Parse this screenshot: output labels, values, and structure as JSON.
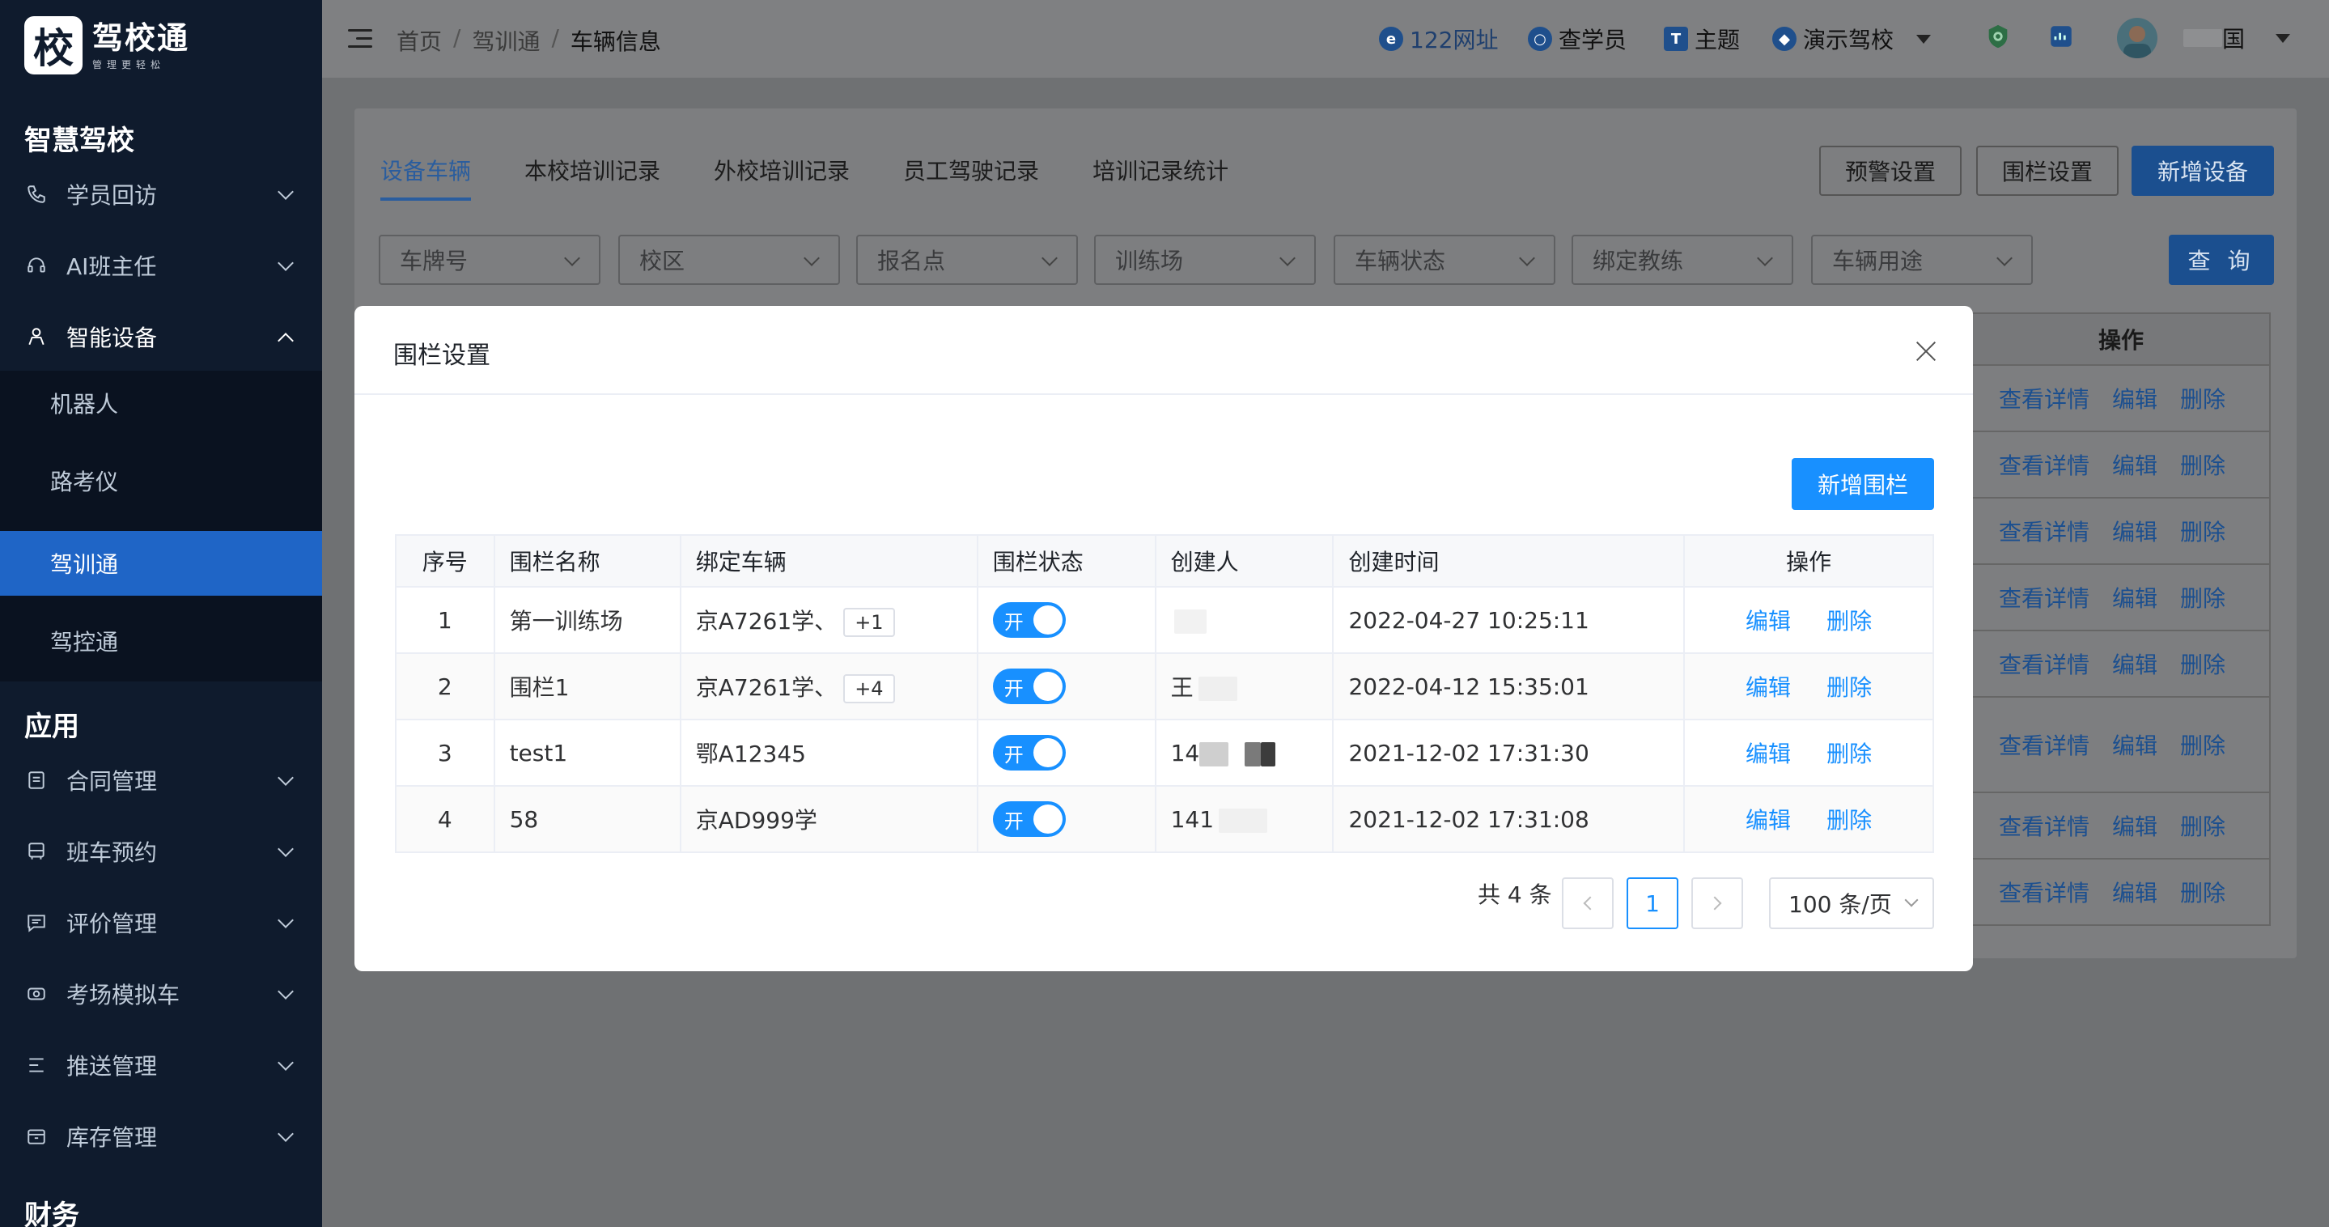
{
  "app": {
    "logo_char": "校",
    "name": "驾校通",
    "tagline": "管理更轻松"
  },
  "sidebar": {
    "sections": [
      {
        "title": "智慧驾校"
      },
      {
        "title": "应用"
      },
      {
        "title": "财务"
      }
    ],
    "items_top": [
      {
        "label": "学员回访",
        "icon": "phone-icon"
      },
      {
        "label": "AI班主任",
        "icon": "headset-icon"
      },
      {
        "label": "智能设备",
        "icon": "device-icon",
        "expanded": true
      }
    ],
    "submenu": [
      {
        "label": "机器人"
      },
      {
        "label": "路考仪"
      },
      {
        "label": "驾训通",
        "active": true
      },
      {
        "label": "驾控通"
      }
    ],
    "items_app": [
      {
        "label": "合同管理",
        "icon": "contract-icon"
      },
      {
        "label": "班车预约",
        "icon": "bus-icon"
      },
      {
        "label": "评价管理",
        "icon": "comment-icon"
      },
      {
        "label": "考场模拟车",
        "icon": "car-icon"
      },
      {
        "label": "推送管理",
        "icon": "push-icon"
      },
      {
        "label": "库存管理",
        "icon": "box-icon"
      }
    ]
  },
  "header": {
    "breadcrumb": [
      "首页",
      "驾训通",
      "车辆信息"
    ],
    "links": [
      {
        "label": "122网址",
        "icon": "ie-icon"
      },
      {
        "label": "查学员",
        "icon": "search-circle-icon"
      },
      {
        "label": "主题",
        "icon": "shirt-icon"
      },
      {
        "label": "演示驾校",
        "icon": "school-icon"
      }
    ],
    "user_suffix": "国"
  },
  "page": {
    "tabs": [
      "设备车辆",
      "本校培训记录",
      "外校培训记录",
      "员工驾驶记录",
      "培训记录统计"
    ],
    "buttons": {
      "warning": "预警设置",
      "fence": "围栏设置",
      "add_device": "新增设备",
      "query": "查 询"
    },
    "filters": [
      "车牌号",
      "校区",
      "报名点",
      "训练场",
      "车辆状态",
      "绑定教练",
      "车辆用途"
    ],
    "bg_table": {
      "op_header": "操作",
      "row_actions": [
        "查看详情",
        "编辑",
        "删除"
      ]
    }
  },
  "modal": {
    "title": "围栏设置",
    "add_button": "新增围栏",
    "columns": [
      "序号",
      "围栏名称",
      "绑定车辆",
      "围栏状态",
      "创建人",
      "创建时间",
      "操作"
    ],
    "rows": [
      {
        "no": "1",
        "name": "第一训练场",
        "vehicle": "京A7261学、",
        "more": "+1",
        "status": "开",
        "creator": "",
        "created": "2022-04-27 10:25:11"
      },
      {
        "no": "2",
        "name": "围栏1",
        "vehicle": "京A7261学、",
        "more": "+4",
        "status": "开",
        "creator": "王",
        "created": "2022-04-12 15:35:01"
      },
      {
        "no": "3",
        "name": "test1",
        "vehicle": "鄂A12345",
        "more": "",
        "status": "开",
        "creator": "14",
        "created": "2021-12-02 17:31:30"
      },
      {
        "no": "4",
        "name": "58",
        "vehicle": "京AD999学",
        "more": "",
        "status": "开",
        "creator": "141",
        "created": "2021-12-02 17:31:08"
      }
    ],
    "row_actions": {
      "edit": "编辑",
      "delete": "删除"
    },
    "pagination": {
      "total_text": "共 4 条",
      "current": "1",
      "page_size": "100 条/页"
    }
  },
  "colors": {
    "sidebar": "#0f1b2d",
    "active": "#1f65c6",
    "primary": "#1890ff"
  }
}
